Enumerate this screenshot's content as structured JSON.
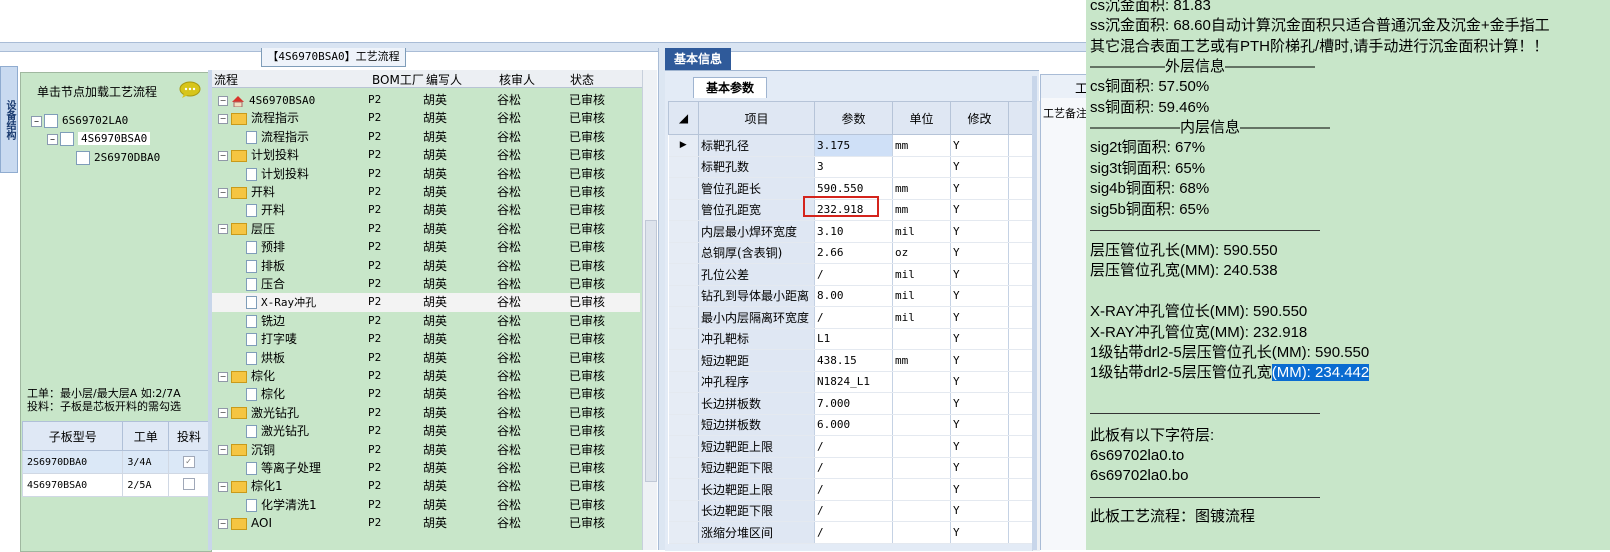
{
  "center_title": "【4S6970BSA0】工艺流程",
  "left_strip_label": "设备结构",
  "left_panel": {
    "header_text": "单击节点加载工艺流程",
    "tree": [
      {
        "label": "6S69702LA0",
        "level": 0,
        "expander": "−"
      },
      {
        "label": "4S6970BSA0",
        "level": 1,
        "expander": "−"
      },
      {
        "label": "2S6970DBA0",
        "level": 2,
        "expander": ""
      }
    ],
    "info_line1": "工单：最小层/最大层A 如:2/7A",
    "info_line2": "投料：子板是芯板开料的需勾选",
    "sub_table": {
      "headers": [
        "子板型号",
        "工单",
        "投料"
      ],
      "rows": [
        {
          "model": "2S6970DBA0",
          "order": "3/4A",
          "checked": true
        },
        {
          "model": "4S6970BSA0",
          "order": "2/5A",
          "checked": false
        }
      ]
    }
  },
  "flow_grid": {
    "headers": {
      "flow": "流程",
      "bom": "BOM工厂",
      "writer": "编写人",
      "reviewer": "核审人",
      "status": "状态"
    },
    "rows": [
      {
        "name": "4S6970BSA0",
        "type": "root",
        "bom": "P2",
        "writer": "胡英",
        "reviewer": "谷松",
        "status": "已审核"
      },
      {
        "name": "流程指示",
        "type": "folder",
        "bom": "P2",
        "writer": "胡英",
        "reviewer": "谷松",
        "status": "已审核"
      },
      {
        "name": "流程指示",
        "type": "leaf",
        "bom": "P2",
        "writer": "胡英",
        "reviewer": "谷松",
        "status": "已审核"
      },
      {
        "name": "计划投料",
        "type": "folder",
        "bom": "P2",
        "writer": "胡英",
        "reviewer": "谷松",
        "status": "已审核"
      },
      {
        "name": "计划投料",
        "type": "leaf",
        "bom": "P2",
        "writer": "胡英",
        "reviewer": "谷松",
        "status": "已审核"
      },
      {
        "name": "开料",
        "type": "folder",
        "bom": "P2",
        "writer": "胡英",
        "reviewer": "谷松",
        "status": "已审核"
      },
      {
        "name": "开料",
        "type": "leaf",
        "bom": "P2",
        "writer": "胡英",
        "reviewer": "谷松",
        "status": "已审核"
      },
      {
        "name": "层压",
        "type": "folder",
        "bom": "P2",
        "writer": "胡英",
        "reviewer": "谷松",
        "status": "已审核"
      },
      {
        "name": "预排",
        "type": "leaf",
        "bom": "P2",
        "writer": "胡英",
        "reviewer": "谷松",
        "status": "已审核"
      },
      {
        "name": "排板",
        "type": "leaf",
        "bom": "P2",
        "writer": "胡英",
        "reviewer": "谷松",
        "status": "已审核"
      },
      {
        "name": "压合",
        "type": "leaf",
        "bom": "P2",
        "writer": "胡英",
        "reviewer": "谷松",
        "status": "已审核"
      },
      {
        "name": "X-Ray冲孔",
        "type": "leaf",
        "selected": true,
        "bom": "P2",
        "writer": "胡英",
        "reviewer": "谷松",
        "status": "已审核"
      },
      {
        "name": "铣边",
        "type": "leaf",
        "bom": "P2",
        "writer": "胡英",
        "reviewer": "谷松",
        "status": "已审核"
      },
      {
        "name": "打字唛",
        "type": "leaf",
        "bom": "P2",
        "writer": "胡英",
        "reviewer": "谷松",
        "status": "已审核"
      },
      {
        "name": "烘板",
        "type": "leaf",
        "bom": "P2",
        "writer": "胡英",
        "reviewer": "谷松",
        "status": "已审核"
      },
      {
        "name": "棕化",
        "type": "folder",
        "bom": "P2",
        "writer": "胡英",
        "reviewer": "谷松",
        "status": "已审核"
      },
      {
        "name": "棕化",
        "type": "leaf",
        "bom": "P2",
        "writer": "胡英",
        "reviewer": "谷松",
        "status": "已审核"
      },
      {
        "name": "激光钻孔",
        "type": "folder",
        "bom": "P2",
        "writer": "胡英",
        "reviewer": "谷松",
        "status": "已审核"
      },
      {
        "name": "激光钻孔",
        "type": "leaf",
        "bom": "P2",
        "writer": "胡英",
        "reviewer": "谷松",
        "status": "已审核"
      },
      {
        "name": "沉铜",
        "type": "folder",
        "bom": "P2",
        "writer": "胡英",
        "reviewer": "谷松",
        "status": "已审核"
      },
      {
        "name": "等离子处理",
        "type": "leaf",
        "bom": "P2",
        "writer": "胡英",
        "reviewer": "谷松",
        "status": "已审核"
      },
      {
        "name": "棕化1",
        "type": "folder",
        "bom": "P2",
        "writer": "胡英",
        "reviewer": "谷松",
        "status": "已审核"
      },
      {
        "name": "化学清洗1",
        "type": "leaf",
        "bom": "P2",
        "writer": "胡英",
        "reviewer": "谷松",
        "status": "已审核"
      },
      {
        "name": "AOI",
        "type": "folder",
        "bom": "P2",
        "writer": "胡英",
        "reviewer": "谷松",
        "status": "已审核"
      }
    ]
  },
  "basic_info": {
    "tab_label": "基本信息",
    "sub_tab_label": "基本参数",
    "headers": {
      "item": "项目",
      "value": "参数",
      "unit": "单位",
      "edit": "修改"
    },
    "rows": [
      {
        "item": "标靶孔径",
        "value": "3.175",
        "unit": "mm",
        "edit": "Y",
        "current": true
      },
      {
        "item": "标靶孔数",
        "value": "3",
        "unit": "",
        "edit": "Y"
      },
      {
        "item": "管位孔距长",
        "value": "590.550",
        "unit": "mm",
        "edit": "Y"
      },
      {
        "item": "管位孔距宽",
        "value": "232.918",
        "unit": "mm",
        "edit": "Y",
        "highlight": true
      },
      {
        "item": "内层最小焊环宽度",
        "value": "3.10",
        "unit": "mil",
        "edit": "Y"
      },
      {
        "item": "总铜厚(含表铜)",
        "value": "2.66",
        "unit": "oz",
        "edit": "Y"
      },
      {
        "item": "孔位公差",
        "value": "/",
        "unit": "mil",
        "edit": "Y"
      },
      {
        "item": "钻孔到导体最小距离",
        "value": "8.00",
        "unit": "mil",
        "edit": "Y"
      },
      {
        "item": "最小内层隔离环宽度",
        "value": "/",
        "unit": "mil",
        "edit": "Y"
      },
      {
        "item": "冲孔靶标",
        "value": "L1",
        "unit": "",
        "edit": "Y"
      },
      {
        "item": "短边靶距",
        "value": "438.15",
        "unit": "mm",
        "edit": "Y"
      },
      {
        "item": "冲孔程序",
        "value": "N1824_L1",
        "unit": "",
        "edit": "Y"
      },
      {
        "item": "长边拼板数",
        "value": "7.000",
        "unit": "",
        "edit": "Y"
      },
      {
        "item": "短边拼板数",
        "value": "6.000",
        "unit": "",
        "edit": "Y"
      },
      {
        "item": "短边靶距上限",
        "value": "/",
        "unit": "",
        "edit": "Y"
      },
      {
        "item": "短边靶距下限",
        "value": "/",
        "unit": "",
        "edit": "Y"
      },
      {
        "item": "长边靶距上限",
        "value": "/",
        "unit": "",
        "edit": "Y"
      },
      {
        "item": "长边靶距下限",
        "value": "/",
        "unit": "",
        "edit": "Y"
      },
      {
        "item": "涨缩分堆区间",
        "value": "/",
        "unit": "",
        "edit": "Y"
      }
    ]
  },
  "right_panel": {
    "tab_char": "工",
    "sub_label": "工艺备注"
  },
  "notes": {
    "line1": "cs沉金面积: 81.83",
    "line2": "ss沉金面积: 68.60自动计算沉金面积只适合普通沉金及沉金+金手指工",
    "line3": "其它混合表面工艺或有PTH阶梯孔/槽时,请手动进行沉金面积计算！！",
    "outer_title": "—————外层信息——————",
    "cs_copper": "cs铜面积: 57.50%",
    "ss_copper": "ss铜面积: 59.46%",
    "inner_title": "——————内层信息——————",
    "sig2t": "sig2t铜面积: 67%",
    "sig3t": "sig3t铜面积: 65%",
    "sig4b": "sig4b铜面积: 68%",
    "sig5b": "sig5b铜面积: 65%",
    "press_len": "层压管位孔长(MM): 590.550",
    "press_wid": "层压管位孔宽(MM): 240.538",
    "xray_len": "X-RAY冲孔管位长(MM): 590.550",
    "xray_wid": "X-RAY冲孔管位宽(MM): 232.918",
    "drl_len": "1级钻带drl2-5层压管位孔长(MM): 590.550",
    "drl_wid_a": "1级钻带drl2-5层压管位孔宽",
    "drl_wid_b": "(MM): 234.442",
    "char_title": "此板有以下字符层:",
    "char1": "6s69702la0.to",
    "char2": "6s69702la0.bo",
    "process_flow": "此板工艺流程：图镀流程"
  }
}
